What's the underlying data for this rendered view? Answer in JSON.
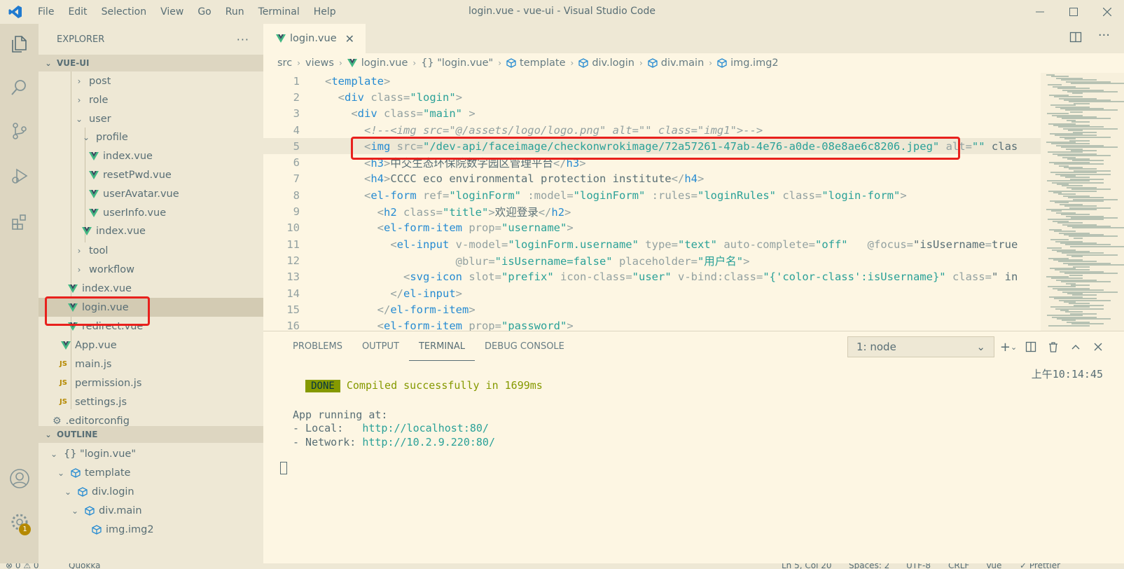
{
  "window": {
    "title": "login.vue - vue-ui - Visual Studio Code",
    "menu": [
      "File",
      "Edit",
      "Selection",
      "View",
      "Go",
      "Run",
      "Terminal",
      "Help"
    ]
  },
  "activity_bar": {
    "items": [
      "explorer-icon",
      "search-icon",
      "source-control-icon",
      "run-debug-icon",
      "extensions-icon",
      "account-icon",
      "settings-gear-icon"
    ],
    "settings_badge": "1"
  },
  "explorer": {
    "header": "EXPLORER",
    "more": "···",
    "project": "VUE-UI",
    "tree": [
      {
        "label": "post",
        "type": "folder",
        "state": "collapsed"
      },
      {
        "label": "role",
        "type": "folder",
        "state": "collapsed"
      },
      {
        "label": "user",
        "type": "folder",
        "state": "expanded"
      },
      {
        "label": "profile",
        "type": "folder",
        "state": "expanded"
      },
      {
        "label": "index.vue",
        "type": "vue"
      },
      {
        "label": "resetPwd.vue",
        "type": "vue"
      },
      {
        "label": "userAvatar.vue",
        "type": "vue"
      },
      {
        "label": "userInfo.vue",
        "type": "vue"
      },
      {
        "label": "index.vue",
        "type": "vue"
      },
      {
        "label": "tool",
        "type": "folder",
        "state": "collapsed"
      },
      {
        "label": "workflow",
        "type": "folder",
        "state": "collapsed"
      },
      {
        "label": "index.vue",
        "type": "vue"
      },
      {
        "label": "login.vue",
        "type": "vue",
        "selected": true
      },
      {
        "label": "redirect.vue",
        "type": "vue"
      },
      {
        "label": "App.vue",
        "type": "vue"
      },
      {
        "label": "main.js",
        "type": "js",
        "icon_text": "JS"
      },
      {
        "label": "permission.js",
        "type": "js",
        "icon_text": "JS"
      },
      {
        "label": "settings.js",
        "type": "js",
        "icon_text": "JS"
      },
      {
        "label": ".editorconfig",
        "type": "config"
      }
    ]
  },
  "outline": {
    "header": "OUTLINE",
    "items": [
      {
        "label": "{} \"login.vue\""
      },
      {
        "label": "template"
      },
      {
        "label": "div.login"
      },
      {
        "label": "div.main"
      },
      {
        "label": "img.img2"
      }
    ]
  },
  "editor": {
    "tab": "login.vue",
    "close": "✕",
    "breadcrumb": [
      "src",
      "views",
      "login.vue",
      "{} \"login.vue\"",
      "template",
      "div.login",
      "div.main",
      "img.img2"
    ],
    "lines": [
      {
        "n": "1",
        "text": "<template>"
      },
      {
        "n": "2",
        "text": "  <div class=\"login\">"
      },
      {
        "n": "3",
        "text": "    <div class=\"main\" >"
      },
      {
        "n": "4",
        "text": "      <!--<img src=\"@/assets/logo/logo.png\" alt=\"\" class=\"img1\">-->"
      },
      {
        "n": "5",
        "text": "      <img src=\"/dev-api/faceimage/checkonwrokimage/72a57261-47ab-4e76-a0de-08e8ae6c8206.jpeg\" alt=\"\" clas"
      },
      {
        "n": "6",
        "text": "      <h3>中交生态环保院数字园区管理平台</h3>"
      },
      {
        "n": "7",
        "text": "      <h4>CCCC eco environmental protection institute</h4>"
      },
      {
        "n": "8",
        "text": "      <el-form ref=\"loginForm\" :model=\"loginForm\" :rules=\"loginRules\" class=\"login-form\">"
      },
      {
        "n": "9",
        "text": "        <h2 class=\"title\">欢迎登录</h2>"
      },
      {
        "n": "10",
        "text": "        <el-form-item prop=\"username\">"
      },
      {
        "n": "11",
        "text": "          <el-input v-model=\"loginForm.username\" type=\"text\" auto-complete=\"off\"   @focus=\"isUsername=true"
      },
      {
        "n": "12",
        "text": "                    @blur=\"isUsername=false\" placeholder=\"用户名\">"
      },
      {
        "n": "13",
        "text": "            <svg-icon slot=\"prefix\" icon-class=\"user\" v-bind:class=\"{'color-class':isUsername}\" class=\" in"
      },
      {
        "n": "14",
        "text": "          </el-input>"
      },
      {
        "n": "15",
        "text": "        </el-form-item>"
      },
      {
        "n": "16",
        "text": "        <el-form-item prop=\"password\">"
      }
    ]
  },
  "panel": {
    "tabs": [
      "PROBLEMS",
      "OUTPUT",
      "TERMINAL",
      "DEBUG CONSOLE"
    ],
    "active_tab": "TERMINAL",
    "terminal_select": "1: node",
    "terminal": {
      "done": "DONE",
      "compiled": "Compiled successfully in 1699ms",
      "timestamp": "上午10:14:45",
      "running": "App running at:",
      "local_label": "- Local:   ",
      "local_url": "http://localhost:80/",
      "network_label": "- Network: ",
      "network_url": "http://10.2.9.220:80/"
    }
  },
  "statusbar": {
    "problems": "⊗ 0 ⚠ 0",
    "quokka": "Quokka",
    "position": "Ln 5, Col 20",
    "spaces": "Spaces: 2",
    "encoding": "UTF-8",
    "eol": "CRLF",
    "language": "Vue",
    "formatter": "✓ Prettier"
  }
}
